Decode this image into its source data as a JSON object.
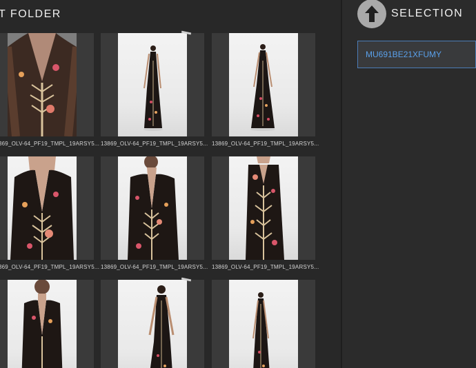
{
  "header": {
    "folder_title": "T FOLDER",
    "selection_title": "SELECTION"
  },
  "selection": {
    "value": "MU691BE21XFUMY"
  },
  "grid": {
    "items": [
      {
        "caption": "369_OLV-64_PF19_TMPL_19ARSY5..."
      },
      {
        "caption": "13869_OLV-64_PF19_TMPL_19ARSY5..."
      },
      {
        "caption": "13869_OLV-64_PF19_TMPL_19ARSY5..."
      },
      {
        "caption": "369_OLV-64_PF19_TMPL_19ARSY5..."
      },
      {
        "caption": "13869_OLV-64_PF19_TMPL_19ARSY5..."
      },
      {
        "caption": "13869_OLV-64_PF19_TMPL_19ARSY5..."
      },
      {
        "caption": ""
      },
      {
        "caption": ""
      },
      {
        "caption": ""
      }
    ]
  },
  "icons": {
    "up": "arrow-up-icon"
  }
}
